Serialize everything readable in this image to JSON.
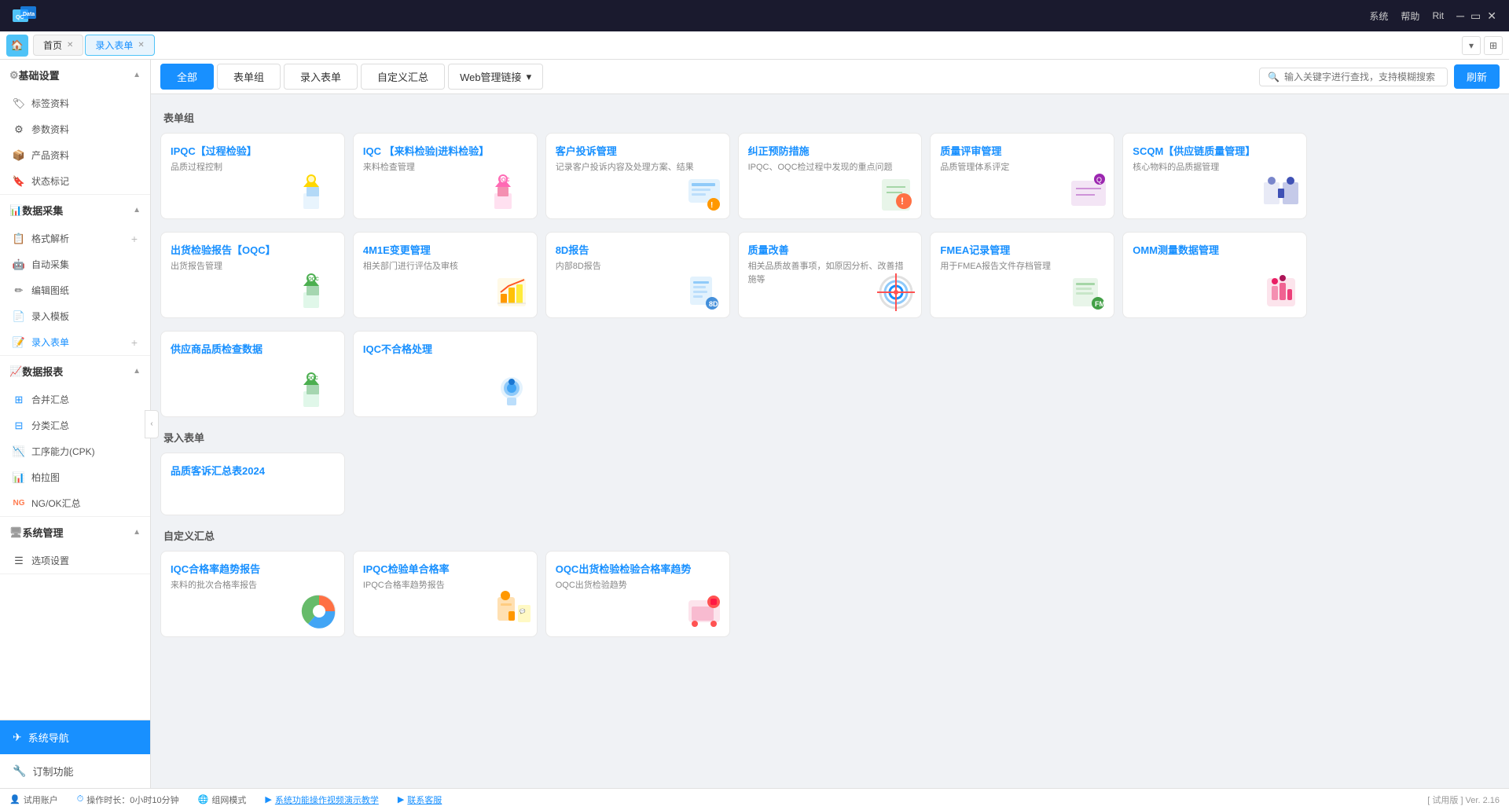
{
  "topbar": {
    "logo": "QCData",
    "logo_qc": "QC",
    "logo_data": "Data",
    "system_label": "系统",
    "help_label": "帮助",
    "user_label": "Rit"
  },
  "tabs": {
    "home_icon": "🏠",
    "items": [
      {
        "label": "首页",
        "closable": true,
        "active": false
      },
      {
        "label": "录入表单",
        "closable": true,
        "active": true
      }
    ]
  },
  "subnav": {
    "buttons": [
      {
        "label": "全部",
        "active": true
      },
      {
        "label": "表单组",
        "active": false
      },
      {
        "label": "录入表单",
        "active": false
      },
      {
        "label": "自定义汇总",
        "active": false
      }
    ],
    "dropdown": "Web管理链接",
    "search_placeholder": "输入关键字进行查找，支持模糊搜索",
    "refresh_label": "刷新"
  },
  "sidebar": {
    "sections": [
      {
        "label": "基础设置",
        "items": [
          {
            "icon": "🏷",
            "label": "标签资料"
          },
          {
            "icon": "⚙",
            "label": "参数资料"
          },
          {
            "icon": "📦",
            "label": "产品资料"
          },
          {
            "icon": "🔖",
            "label": "状态标记"
          }
        ]
      },
      {
        "label": "数据采集",
        "items": [
          {
            "icon": "📋",
            "label": "格式解析",
            "add": true
          },
          {
            "icon": "🤖",
            "label": "自动采集"
          },
          {
            "icon": "✏",
            "label": "编辑图纸"
          },
          {
            "icon": "📄",
            "label": "录入模板"
          },
          {
            "icon": "📝",
            "label": "录入表单",
            "add": true
          }
        ]
      },
      {
        "label": "数据报表",
        "items": [
          {
            "icon": "📊",
            "label": "合并汇总"
          },
          {
            "icon": "📈",
            "label": "分类汇总"
          },
          {
            "icon": "📉",
            "label": "工序能力(CPK)"
          },
          {
            "icon": "📊",
            "label": "柏拉图"
          },
          {
            "icon": "NG",
            "label": "NG/OK汇总",
            "ng": true
          }
        ]
      },
      {
        "label": "系统管理",
        "items": [
          {
            "icon": "⚙",
            "label": "选项设置"
          }
        ]
      }
    ],
    "nav_items": [
      {
        "icon": "✈",
        "label": "系统导航",
        "active": true
      },
      {
        "icon": "🔧",
        "label": "订制功能",
        "active": false
      }
    ]
  },
  "content": {
    "group1_label": "表单组",
    "cards_row1": [
      {
        "title": "IPQC【过程检验】",
        "desc": "品质过程控制",
        "color": "#1890ff"
      },
      {
        "title": "IQC 【来料检验|进料检验】",
        "desc": "来料检查管理",
        "color": "#1890ff"
      },
      {
        "title": "客户投诉管理",
        "desc": "记录客户投诉内容及处理方案、结果",
        "color": "#1890ff"
      },
      {
        "title": "纠正预防措施",
        "desc": "IPQC、OQC检过程中发现的重点问题",
        "color": "#1890ff"
      },
      {
        "title": "质量评审管理",
        "desc": "品质管理体系评定",
        "color": "#1890ff"
      },
      {
        "title": "SCQM【供应链质量管理】",
        "desc": "核心物料的品质据管理",
        "color": "#1890ff"
      }
    ],
    "cards_row2": [
      {
        "title": "出货检验报告【OQC】",
        "desc": "出货报告管理",
        "color": "#1890ff"
      },
      {
        "title": "4M1E变更管理",
        "desc": "相关部门进行评估及审核",
        "color": "#1890ff"
      },
      {
        "title": "8D报告",
        "desc": "内部8D报告",
        "color": "#1890ff"
      },
      {
        "title": "质量改善",
        "desc": "相关品质故善事项，如原因分析、改善措施等",
        "color": "#1890ff"
      },
      {
        "title": "FMEA记录管理",
        "desc": "用于FMEA报告文件存档管理",
        "color": "#1890ff"
      },
      {
        "title": "OMM测量数据管理",
        "desc": "",
        "color": "#1890ff"
      }
    ],
    "cards_row3": [
      {
        "title": "供应商品质检查数据",
        "desc": "",
        "color": "#1890ff"
      },
      {
        "title": "IQC不合格处理",
        "desc": "",
        "color": "#1890ff"
      }
    ],
    "group2_label": "录入表单",
    "cards_group2": [
      {
        "title": "品质客诉汇总表2024",
        "desc": "",
        "color": "#1890ff"
      }
    ],
    "group3_label": "自定义汇总",
    "cards_group3": [
      {
        "title": "IQC合格率趋势报告",
        "desc": "来料的批次合格率报告",
        "color": "#1890ff"
      },
      {
        "title": "IPQC检验单合格率",
        "desc": "IPQC合格率趋势报告",
        "color": "#1890ff"
      },
      {
        "title": "OQC出货检验检验合格率趋势",
        "desc": "OQC出货检验趋势",
        "color": "#1890ff"
      }
    ]
  },
  "bottombar": {
    "account": "试用账户",
    "work_time_label": "操作时长：0小时10分钟",
    "mode": "组网模式",
    "help1": "系统功能操作视频演示教学",
    "help2": "联系客服",
    "version": "[ 试用版 ] Ver. 2.16"
  }
}
